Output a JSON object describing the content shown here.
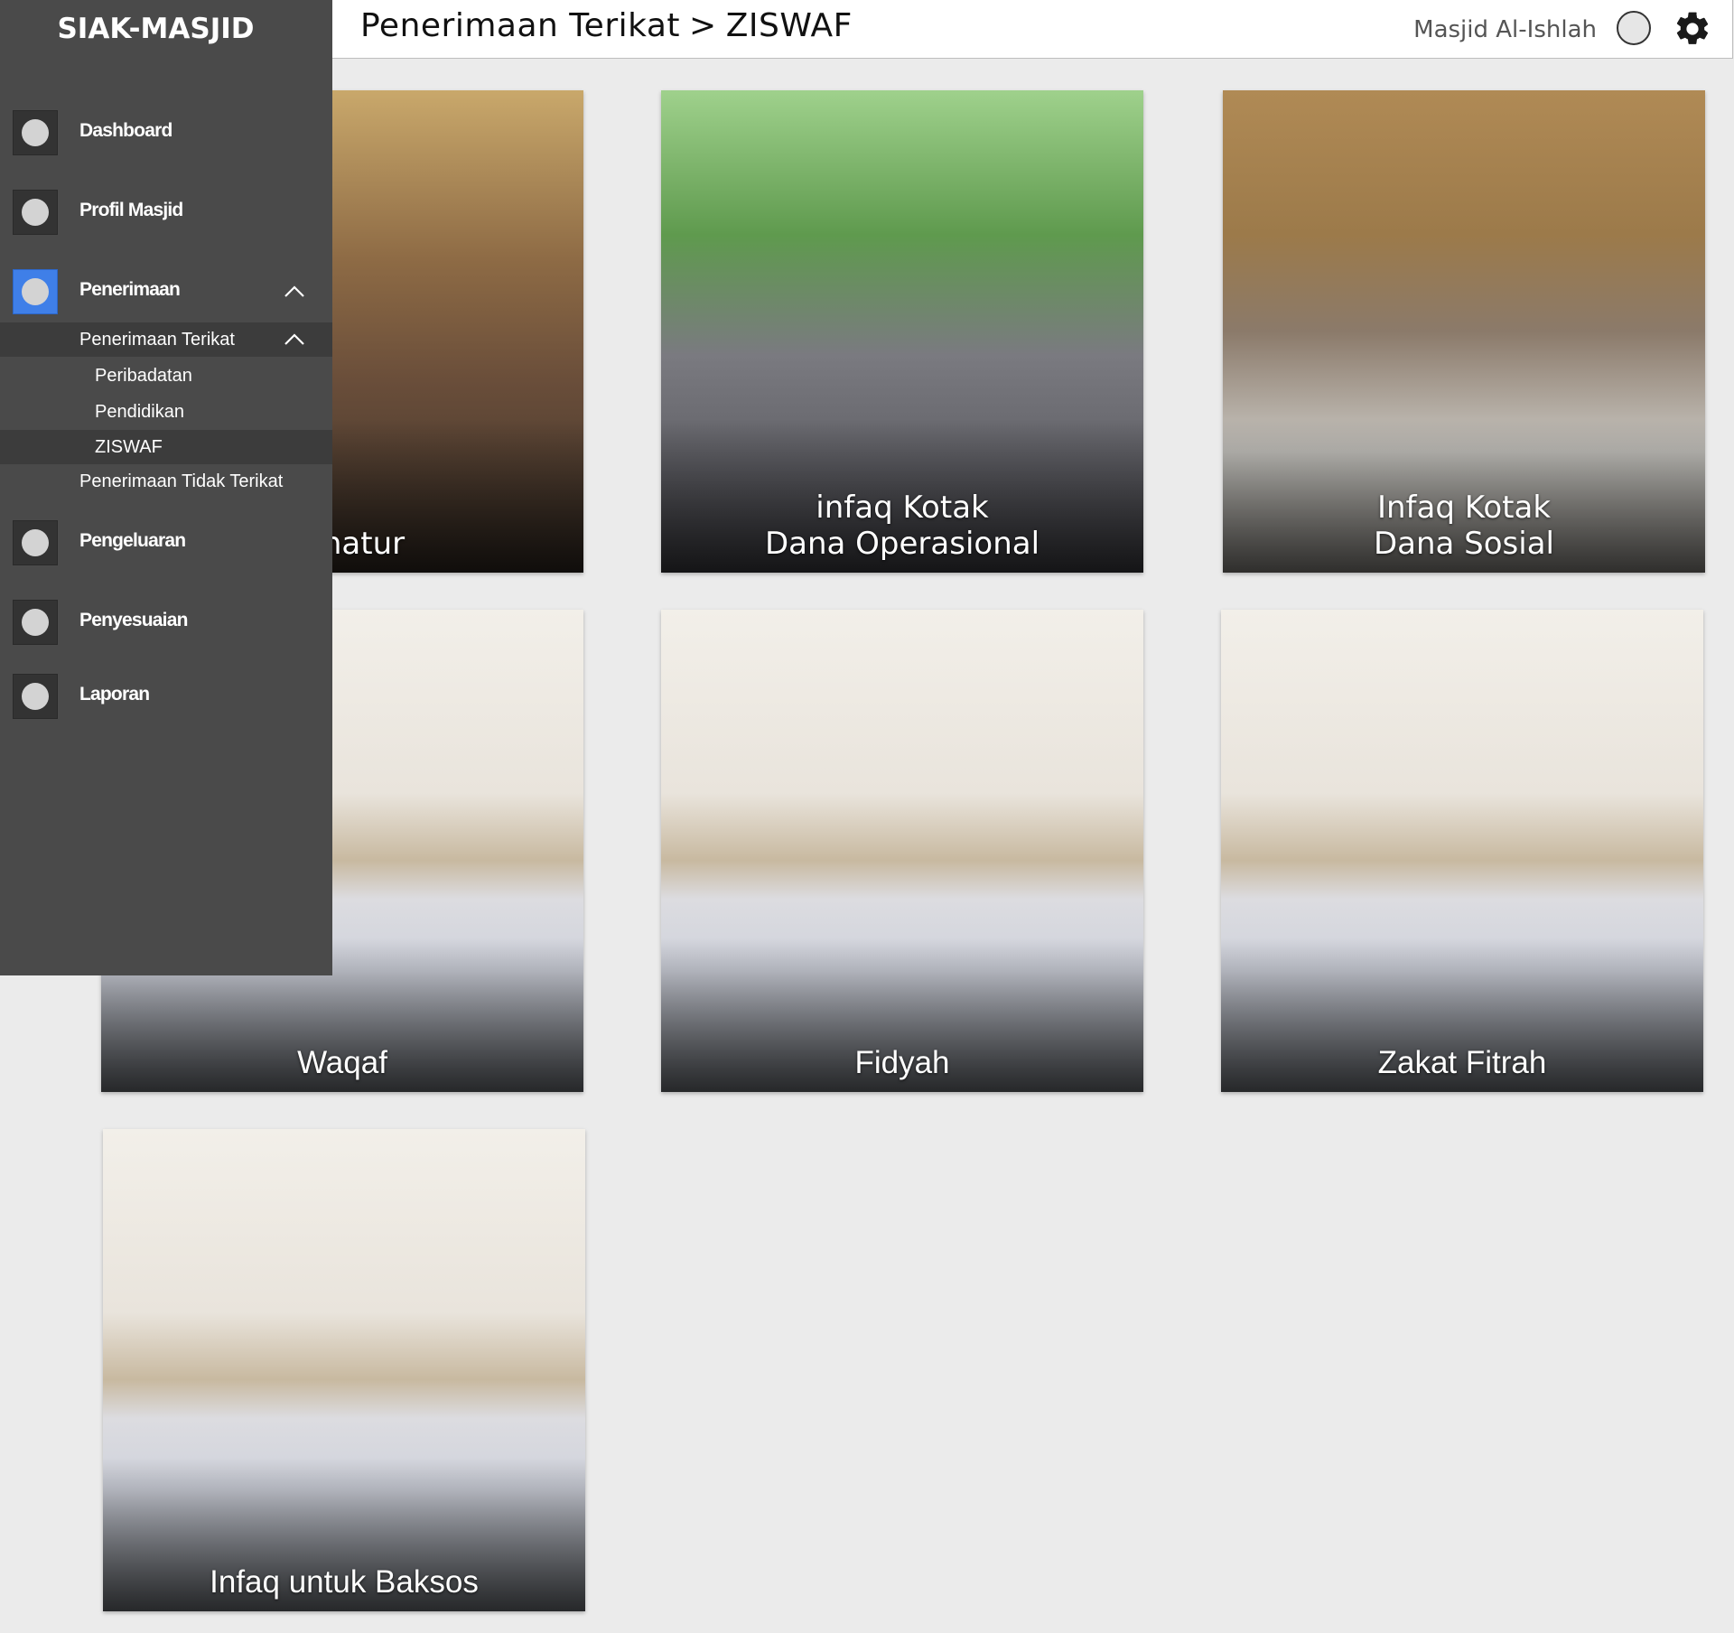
{
  "app": {
    "title": "SIAK-MASJID"
  },
  "header": {
    "breadcrumb_parent": "Penerimaan Terikat",
    "breadcrumb_sep": ">",
    "breadcrumb_current": "ZISWAF",
    "mosque_name": "Masjid Al-Ishlah",
    "icons": {
      "avatar": "user-avatar-icon",
      "settings": "gear-icon"
    }
  },
  "sidebar": {
    "items": [
      {
        "label": "Dashboard"
      },
      {
        "label": "Profil Masjid"
      },
      {
        "label": "Penerimaan",
        "active": true,
        "expanded": true
      },
      {
        "label": "Pengeluaran"
      },
      {
        "label": "Penyesuaian"
      },
      {
        "label": "Laporan"
      }
    ],
    "sub": {
      "terikat": "Penerimaan Terikat",
      "peribadatan": "Peribadatan",
      "pendidikan": "Pendidikan",
      "ziswaf": "ZISWAF",
      "tidak_terikat": "Penerimaan Tidak Terikat"
    },
    "active_color": "#3f7fe8"
  },
  "cards": [
    {
      "caption": [
        "Donatur"
      ]
    },
    {
      "caption": [
        "infaq Kotak",
        "Dana Operasional"
      ]
    },
    {
      "caption": [
        "Infaq Kotak",
        "Dana Sosial"
      ]
    },
    {
      "caption": [
        "Waqaf"
      ]
    },
    {
      "caption": [
        "Fidyah"
      ]
    },
    {
      "caption": [
        "Zakat Fitrah"
      ]
    },
    {
      "caption": [
        "Infaq untuk Baksos"
      ]
    }
  ]
}
